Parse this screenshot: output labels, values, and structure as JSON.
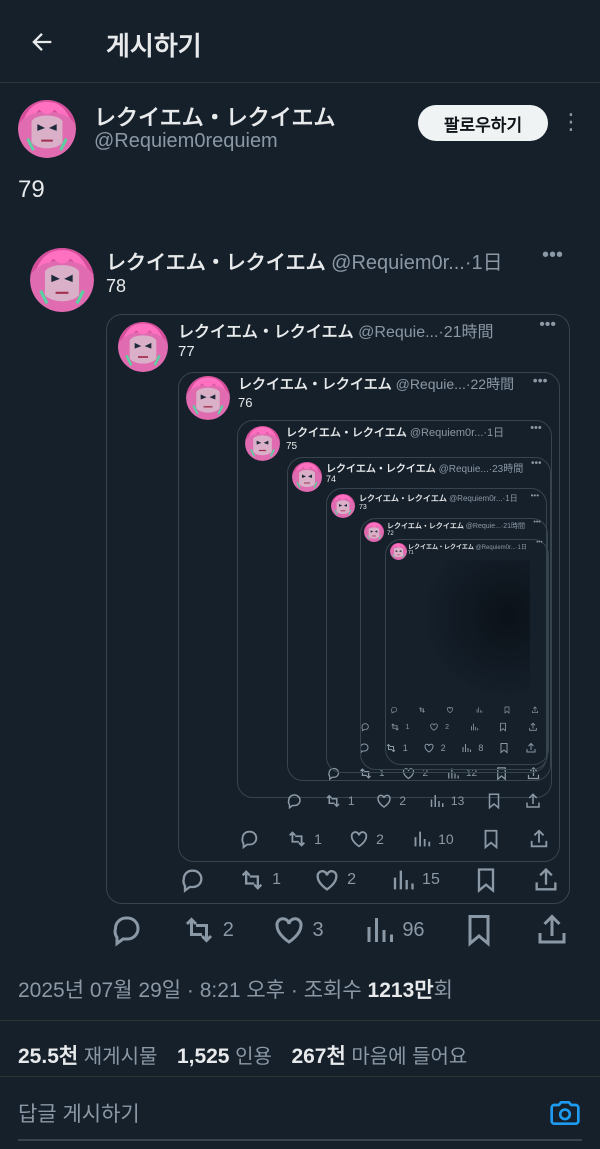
{
  "header": {
    "title": "게시하기"
  },
  "post": {
    "author_name": "レクイエム・レクイエム",
    "author_handle": "@Requiem0requiem",
    "follow_label": "팔로우하기",
    "text": "79"
  },
  "quotes": [
    {
      "name": "レクイエム・レクイエム",
      "handle": "@Requiem0r...",
      "time": "·1日",
      "text": "78",
      "reply": "",
      "retweets": "2",
      "likes": "3",
      "views": "96"
    },
    {
      "name": "レクイエム・レクイエム",
      "handle": "@Requie...",
      "time": "·21時間",
      "text": "77",
      "reply": "",
      "retweets": "1",
      "likes": "2",
      "views": "15"
    },
    {
      "name": "レクイエム・レクイエム",
      "handle": "@Requie...",
      "time": "·22時間",
      "text": "76",
      "reply": "",
      "retweets": "1",
      "likes": "2",
      "views": "10"
    },
    {
      "name": "レクイエム・レクイエム",
      "handle": "@Requiem0r...",
      "time": "·1日",
      "text": "75",
      "reply": "",
      "retweets": "1",
      "likes": "2",
      "views": "13"
    },
    {
      "name": "レクイエム・レクイエム",
      "handle": "@Requie...",
      "time": "·23時間",
      "text": "74",
      "reply": "",
      "retweets": "1",
      "likes": "2",
      "views": "12"
    },
    {
      "name": "レクイエム・レクイエム",
      "handle": "@Requiem0r...",
      "time": "·1日",
      "text": "73",
      "reply": "",
      "retweets": "1",
      "likes": "2",
      "views": "8"
    },
    {
      "name": "レクイエム・レクイエム",
      "handle": "@Requie...",
      "time": "·21時間",
      "text": "72",
      "reply": "",
      "retweets": "1",
      "likes": "2",
      "views": ""
    },
    {
      "name": "レクイエム・レクイエム",
      "handle": "@Requiem0r...",
      "time": "·1日",
      "text": "71",
      "reply": "",
      "retweets": "",
      "likes": "",
      "views": ""
    }
  ],
  "meta": {
    "date": "2025년 07월 29일 · 8:21 오후 · 조회수 ",
    "views": "1213만",
    "views_suffix": "회"
  },
  "stats": {
    "reposts_count": "25.5천",
    "reposts_label": "재게시물",
    "quotes_count": "1,525",
    "quotes_label": "인용",
    "likes_count": "267천",
    "likes_label": "마음에 들어요"
  },
  "reply": {
    "placeholder": "답글 게시하기"
  },
  "icons": {
    "back": "arrow-left-icon",
    "more": "more-dots-icon",
    "reply": "reply-icon",
    "repost": "repost-icon",
    "like": "heart-icon",
    "views": "bar-chart-icon",
    "bookmark": "bookmark-icon",
    "share": "share-icon",
    "camera": "camera-icon"
  },
  "colors": {
    "background": "#15202b",
    "accent": "#1d9bf0",
    "muted": "#8b98a5",
    "text": "#e7e9ea"
  }
}
